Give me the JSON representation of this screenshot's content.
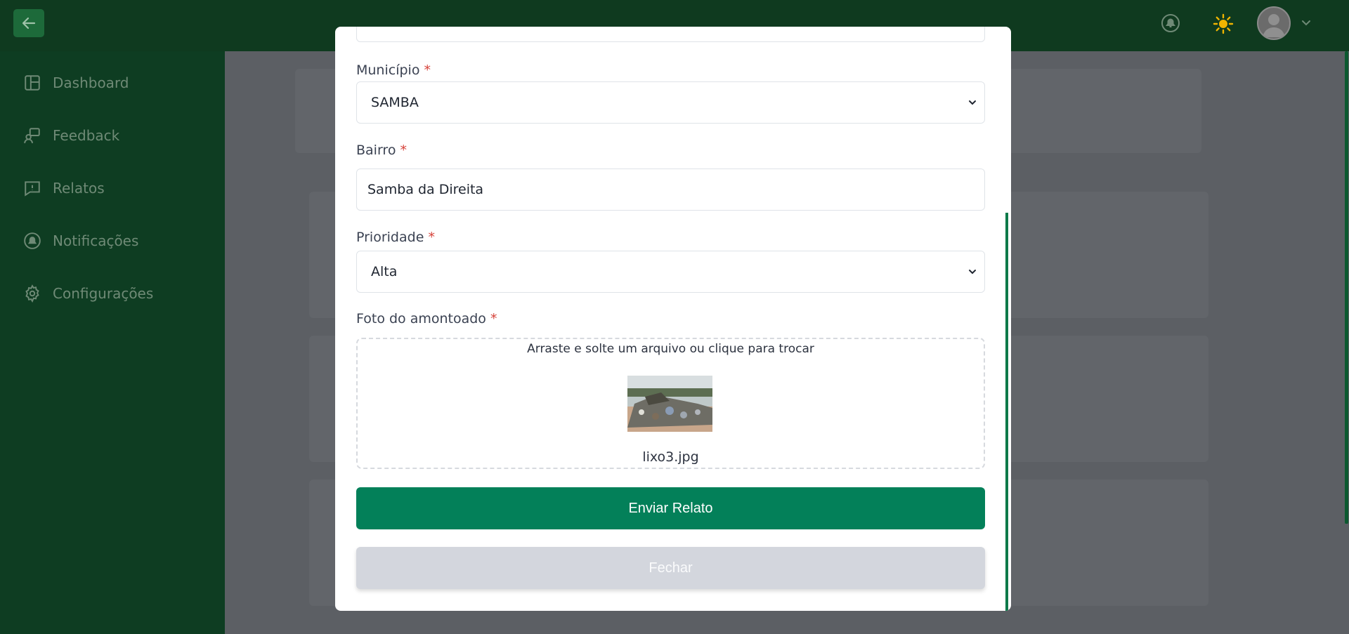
{
  "sidebar": {
    "items": [
      {
        "label": "Dashboard",
        "icon": "layout-icon"
      },
      {
        "label": "Feedback",
        "icon": "feedback-icon"
      },
      {
        "label": "Relatos",
        "icon": "report-icon"
      },
      {
        "label": "Notificações",
        "icon": "bell-icon"
      },
      {
        "label": "Configurações",
        "icon": "gear-icon"
      }
    ]
  },
  "form": {
    "municipio_label": "Município",
    "municipio_value": "SAMBA",
    "bairro_label": "Bairro",
    "bairro_value": "Samba da Direita",
    "prioridade_label": "Prioridade",
    "prioridade_value": "Alta",
    "foto_label": "Foto do amontoado",
    "required_mark": "*",
    "dropzone_text": "Arraste e solte um arquivo ou clique para trocar",
    "file_name": "lixo3.jpg",
    "submit_label": "Enviar Relato",
    "close_label": "Fechar"
  },
  "colors": {
    "primary": "#038059",
    "sidebar": "#0e3d22",
    "required": "#d6423a",
    "sun": "#f0b400"
  }
}
